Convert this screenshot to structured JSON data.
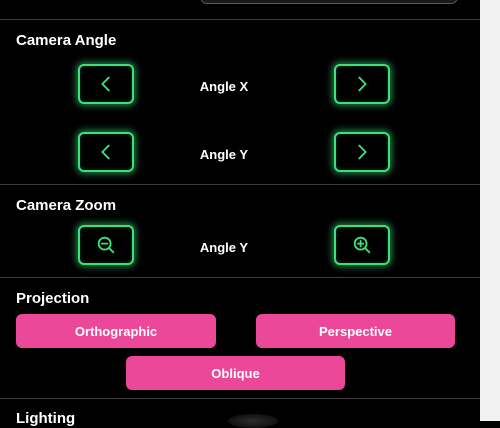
{
  "camera_angle": {
    "title": "Camera Angle",
    "rows": [
      {
        "label": "Angle X"
      },
      {
        "label": "Angle Y"
      }
    ]
  },
  "camera_zoom": {
    "title": "Camera Zoom",
    "label": "Angle Y"
  },
  "projection": {
    "title": "Projection",
    "options": [
      "Orthographic",
      "Perspective",
      "Oblique"
    ]
  },
  "lighting": {
    "title": "Lighting"
  },
  "icons": {
    "decrease": "chevron-left-icon",
    "increase": "chevron-right-icon",
    "zoom_out": "zoom-out-icon",
    "zoom_in": "zoom-in-icon"
  },
  "colors": {
    "background": "#000000",
    "glow_accent": "#3de07a",
    "pink_accent": "#ec4899",
    "divider": "#3b3b3b"
  }
}
